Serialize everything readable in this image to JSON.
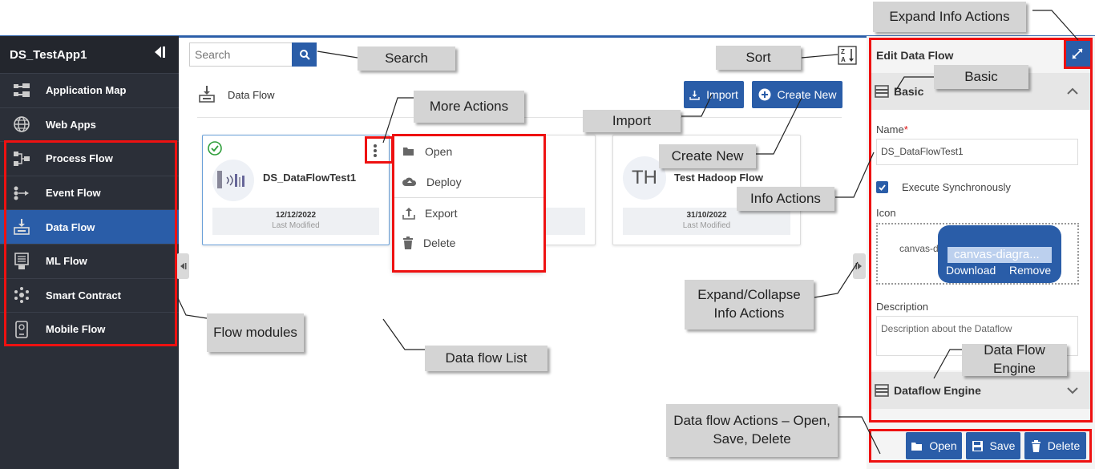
{
  "sidebar": {
    "app_title": "DS_TestApp1",
    "items": [
      {
        "label": "Application Map",
        "icon": "app-map-icon"
      },
      {
        "label": "Web Apps",
        "icon": "globe-icon"
      },
      {
        "label": "Process Flow",
        "icon": "process-flow-icon"
      },
      {
        "label": "Event Flow",
        "icon": "event-flow-icon"
      },
      {
        "label": "Data Flow",
        "icon": "data-flow-icon",
        "active": true
      },
      {
        "label": "ML Flow",
        "icon": "ml-flow-icon"
      },
      {
        "label": "Smart Contract",
        "icon": "smart-contract-icon"
      },
      {
        "label": "Mobile Flow",
        "icon": "mobile-flow-icon"
      }
    ]
  },
  "main": {
    "search_placeholder": "Search",
    "section_title": "Data Flow",
    "import_label": "Import",
    "create_new_label": "Create New",
    "cards": [
      {
        "name": "DS_DataFlowTest1",
        "date": "12/12/2022",
        "modified_label": "Last Modified",
        "selected": true
      },
      {
        "name": "",
        "date": "",
        "modified_label": ""
      },
      {
        "name": "Test Hadoop Flow",
        "initials": "TH",
        "date": "31/10/2022",
        "modified_label": "Last Modified"
      }
    ],
    "context_menu": [
      "Open",
      "Deploy",
      "Export",
      "Delete"
    ]
  },
  "info_panel": {
    "title": "Edit Data Flow",
    "basic_section": "Basic",
    "name_label": "Name",
    "required_mark": "*",
    "name_value": "DS_DataFlowTest1",
    "execute_sync_label": "Execute Synchronously",
    "execute_sync_checked": true,
    "icon_label": "Icon",
    "icon_alt": "canvas-d",
    "icon_file": "canvas-diagra...",
    "download_label": "Download",
    "remove_label": "Remove",
    "description_label": "Description",
    "description_placeholder": "Description about the Dataflow",
    "engine_section": "Dataflow Engine",
    "actions": {
      "open": "Open",
      "save": "Save",
      "delete": "Delete"
    }
  },
  "annotations": {
    "expand_info": "Expand Info Actions",
    "search": "Search",
    "sort": "Sort",
    "basic": "Basic",
    "more_actions": "More Actions",
    "import": "Import",
    "create_new": "Create New",
    "info_actions": "Info Actions",
    "expand_collapse": "Expand/Collapse Info Actions",
    "flow_modules": "Flow modules",
    "data_flow_list": "Data flow  List",
    "data_flow_engine": "Data Flow Engine",
    "data_flow_actions": "Data flow Actions – Open, Save, Delete"
  },
  "colors": {
    "accent": "#2a5da8",
    "sidebar_bg": "#2b2f38",
    "annotation_red": "#e11111",
    "callout_bg": "#d4d4d4"
  }
}
